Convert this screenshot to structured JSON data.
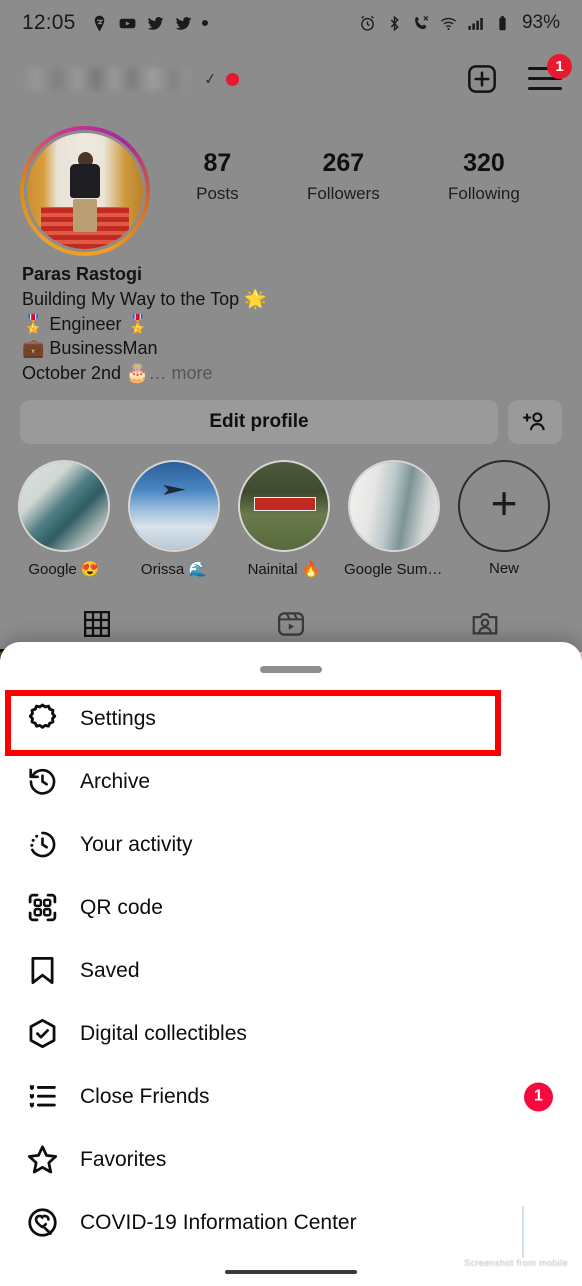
{
  "status_bar": {
    "time": "12:05",
    "left_icons": [
      "location-pin-icon",
      "youtube-icon",
      "twitter-icon",
      "twitter-icon",
      "dot-icon"
    ],
    "right_icons": [
      "alarm-icon",
      "bluetooth-icon",
      "call-mute-icon",
      "wifi-icon",
      "cellular-signal-icon",
      "battery-icon"
    ],
    "battery": "93%"
  },
  "profile": {
    "username_blurred": "",
    "verified_tick": "✓",
    "menu_badge": "1",
    "stats": [
      {
        "value": "87",
        "label": "Posts"
      },
      {
        "value": "267",
        "label": "Followers"
      },
      {
        "value": "320",
        "label": "Following"
      }
    ],
    "display_name": "Paras Rastogi",
    "bio_lines": [
      "Building My Way to the Top 🌟",
      "🎖️ Engineer 🎖️",
      "💼 BusinessMan"
    ],
    "bio_last_line": "October 2nd 🎂",
    "bio_more": "… more",
    "edit_profile_label": "Edit profile",
    "add_person_icon": "add-person-icon"
  },
  "highlights": [
    {
      "label": "Google 😍",
      "thumb": "thumb-google"
    },
    {
      "label": "Orissa 🌊",
      "thumb": "thumb-orissa"
    },
    {
      "label": "Nainital 🔥",
      "thumb": "thumb-nainital"
    },
    {
      "label": "Google Summit❤️",
      "thumb": "thumb-summit"
    },
    {
      "label": "New",
      "thumb": "new-highlight",
      "plus": "+"
    }
  ],
  "tabs": [
    {
      "name": "grid-tab",
      "icon": "grid-icon",
      "active": true
    },
    {
      "name": "reels-tab",
      "icon": "reels-icon",
      "active": false
    },
    {
      "name": "tagged-tab",
      "icon": "tagged-icon",
      "active": false
    }
  ],
  "sheet": {
    "menu_items": [
      {
        "label": "Settings",
        "icon": "gear-icon",
        "badge": "",
        "highlighted": true
      },
      {
        "label": "Archive",
        "icon": "archive-clock-icon",
        "badge": ""
      },
      {
        "label": "Your activity",
        "icon": "activity-clock-icon",
        "badge": ""
      },
      {
        "label": "QR code",
        "icon": "qr-code-icon",
        "badge": ""
      },
      {
        "label": "Saved",
        "icon": "bookmark-icon",
        "badge": ""
      },
      {
        "label": "Digital collectibles",
        "icon": "shield-check-icon",
        "badge": ""
      },
      {
        "label": "Close Friends",
        "icon": "close-friends-list-icon",
        "badge": "1"
      },
      {
        "label": "Favorites",
        "icon": "star-icon",
        "badge": ""
      },
      {
        "label": "COVID-19 Information Center",
        "icon": "covid-info-icon",
        "badge": ""
      }
    ]
  },
  "colors": {
    "highlight_red": "#ff0000",
    "badge_red": "#f40a3c",
    "dim_overlay": "#8c8c8c",
    "sheet_bg": "#ffffff"
  },
  "watermark": "Screenshot from mobile"
}
